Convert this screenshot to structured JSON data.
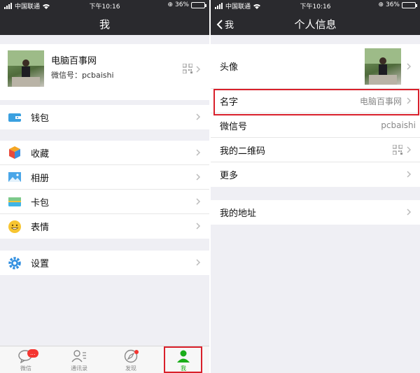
{
  "status": {
    "carrier": "中国联通",
    "time": "下午10:16",
    "battery": "36%"
  },
  "left_screen": {
    "title": "我",
    "profile": {
      "name": "电脑百事网",
      "wechat_id": "微信号：pcbaishi"
    },
    "items": [
      {
        "label": "钱包",
        "icon": "wallet-icon"
      },
      {
        "label": "收藏",
        "icon": "favorites-cube-icon"
      },
      {
        "label": "相册",
        "icon": "photo-album-icon"
      },
      {
        "label": "卡包",
        "icon": "card-wallet-icon"
      },
      {
        "label": "表情",
        "icon": "smiley-icon"
      },
      {
        "label": "设置",
        "icon": "gear-icon"
      }
    ],
    "tabs": [
      {
        "label": "微信",
        "badge": "..."
      },
      {
        "label": "通讯录"
      },
      {
        "label": "发现"
      },
      {
        "label": "我"
      }
    ]
  },
  "right_screen": {
    "title": "个人信息",
    "back_label": "我",
    "rows": [
      {
        "label": "头像"
      },
      {
        "label": "名字",
        "value": "电脑百事网"
      },
      {
        "label": "微信号",
        "value": "pcbaishi"
      },
      {
        "label": "我的二维码"
      },
      {
        "label": "更多"
      },
      {
        "label": "我的地址"
      }
    ]
  },
  "colors": {
    "navbar": "#2a2a2e",
    "accent_green": "#1aad19",
    "highlight_red": "#d9202b",
    "badge_red": "#f43530"
  }
}
